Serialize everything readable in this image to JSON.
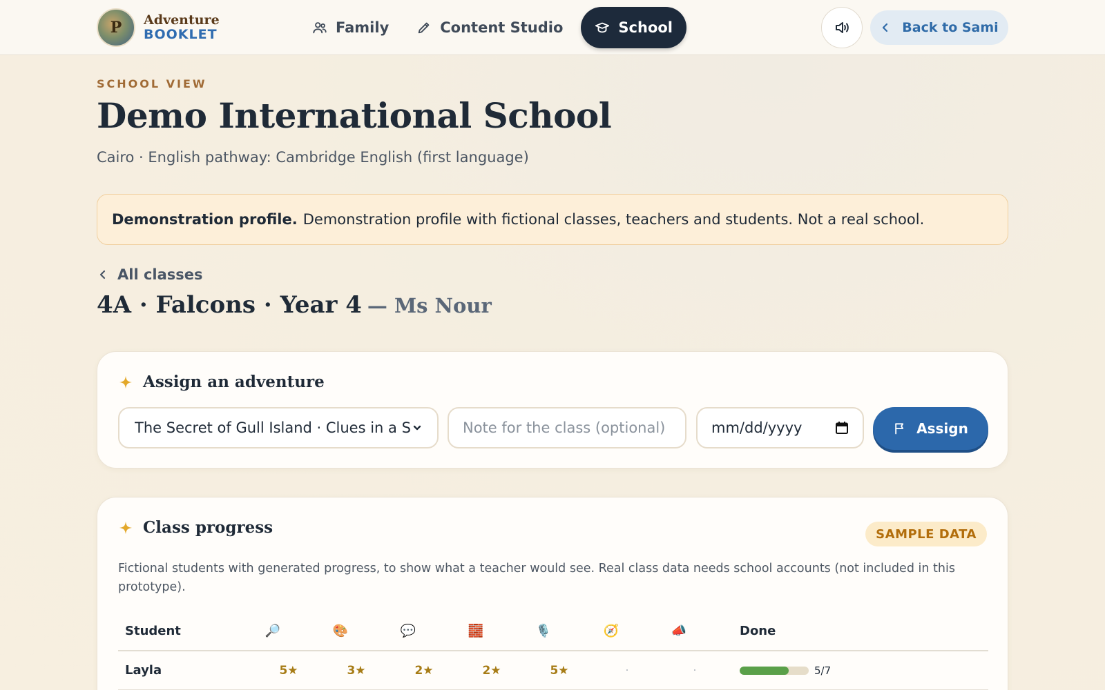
{
  "header": {
    "logo_mark": "P",
    "logo_line1": "Adventure",
    "logo_line2": "BOOKLET",
    "nav": [
      {
        "label": "Family",
        "icon": "users-icon"
      },
      {
        "label": "Content Studio",
        "icon": "pencil-icon"
      },
      {
        "label": "School",
        "icon": "graduation-cap-icon",
        "active": true
      }
    ],
    "sound_icon": "speaker-icon",
    "back_label": "Back to Sami"
  },
  "page": {
    "eyebrow": "SCHOOL VIEW",
    "title": "Demo International School",
    "subtitle": "Cairo · English pathway: Cambridge English (first language)"
  },
  "notice": {
    "bold": "Demonstration profile.",
    "text": "Demonstration profile with fictional classes, teachers and students. Not a real school."
  },
  "class": {
    "back_label": "All classes",
    "name": "4A · Falcons · Year 4",
    "teacher": "— Ms Nour"
  },
  "assign": {
    "title": "Assign an adventure",
    "selected_adventure": "The Secret of Gull Island · Clues in a S",
    "note_placeholder": "Note for the class (optional)",
    "date_placeholder": "mm/dd/yyyy",
    "button_label": "Assign"
  },
  "progress": {
    "title": "Class progress",
    "badge": "SAMPLE DATA",
    "description": "Fictional students with generated progress, to show what a teacher would see. Real class data needs school accounts (not included in this prototype).",
    "columns": {
      "student": "Student",
      "skills": [
        "🔎",
        "🎨",
        "💬",
        "🧱",
        "🎙️",
        "🧭",
        "📣"
      ],
      "done": "Done"
    },
    "rows": [
      {
        "name": "Layla",
        "scores": [
          "5★",
          "3★",
          "2★",
          "2★",
          "5★",
          "·",
          "·"
        ],
        "done_count": 5,
        "done_total": 7,
        "done_label": "5/7"
      }
    ]
  },
  "colors": {
    "accent_blue": "#2c68ab",
    "nav_active": "#1d2a3b",
    "star_gold": "#a77c16",
    "progress_green": "#5aa049",
    "badge_bg": "#fcebc9"
  }
}
